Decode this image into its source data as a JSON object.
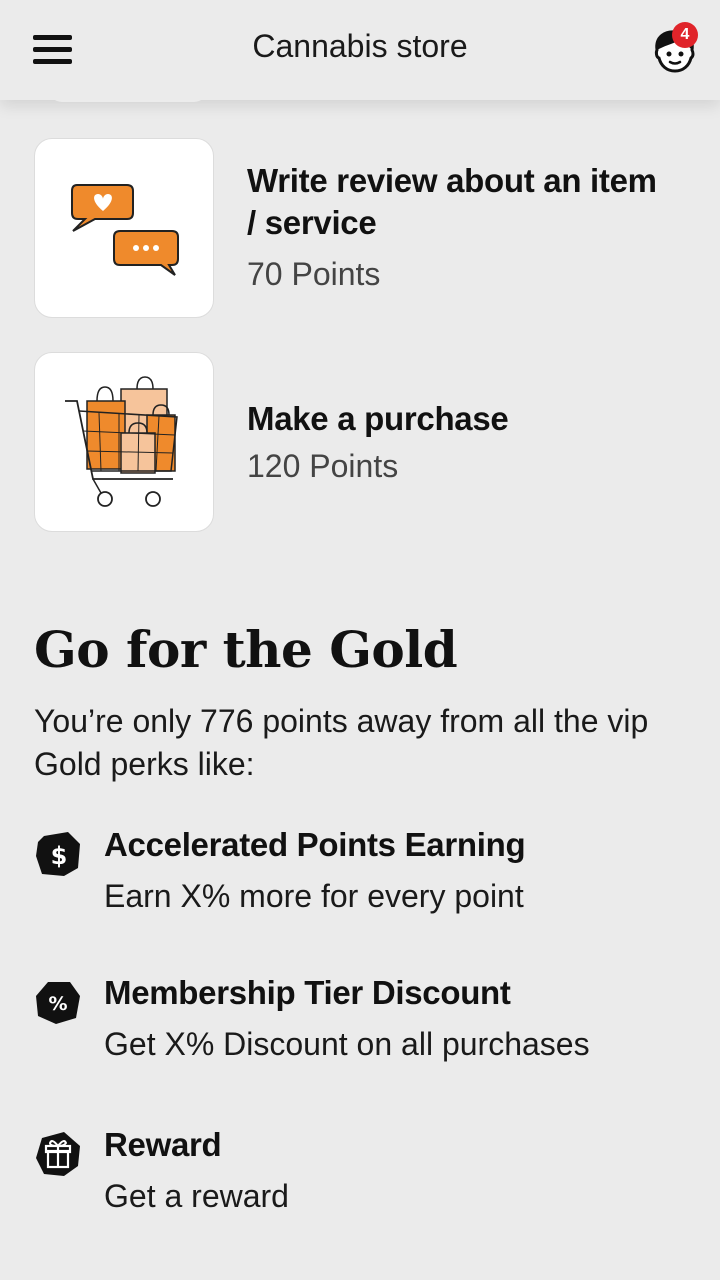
{
  "header": {
    "title": "Cannabis store",
    "notification_count": "4",
    "menu_icon": "hamburger-menu-icon",
    "avatar_icon": "face-avatar-icon"
  },
  "tasks": [
    {
      "name": "Write review about an item / service",
      "points": "70 Points",
      "icon": "chat-bubbles-heart-icon"
    },
    {
      "name": "Make a purchase",
      "points": "120 Points",
      "icon": "shopping-cart-bags-icon"
    }
  ],
  "gold": {
    "title": "Go for the Gold",
    "description": "You’re only 776 points away from all the vip Gold perks like:"
  },
  "perks": [
    {
      "title": "Accelerated Points Earning",
      "description": "Earn X% more for every point",
      "icon": "dollar-icon"
    },
    {
      "title": "Membership Tier Discount",
      "description": "Get X% Discount on all purchases",
      "icon": "percent-icon"
    },
    {
      "title": "Reward",
      "description": "Get a reward",
      "icon": "gift-icon"
    }
  ],
  "colors": {
    "accent_orange": "#ef8a2c",
    "badge_red": "#e0242a",
    "background": "#ebebeb"
  }
}
